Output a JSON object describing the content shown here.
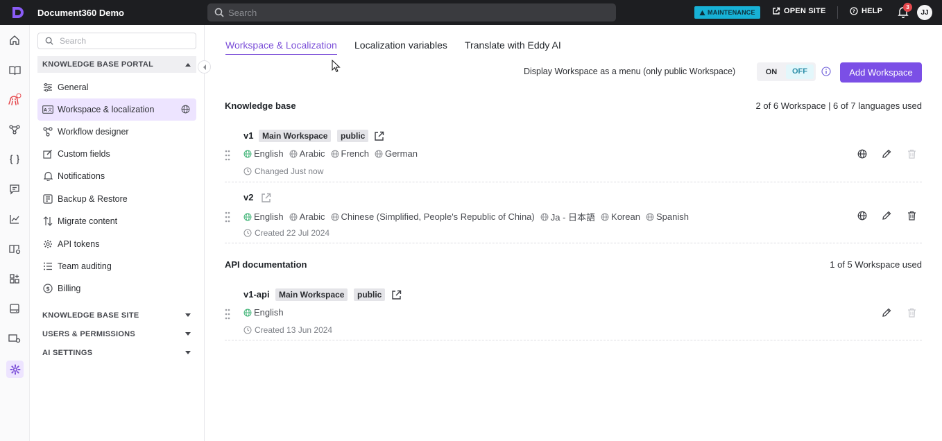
{
  "header": {
    "app_title": "Document360 Demo",
    "search_placeholder": "Search",
    "maintenance_label": "MAINTENANCE",
    "open_site_label": "OPEN SITE",
    "help_label": "HELP",
    "notification_count": "3",
    "user_initials": "JJ"
  },
  "sidebar": {
    "search_placeholder": "Search",
    "portal_section": "KNOWLEDGE BASE PORTAL",
    "items": [
      {
        "label": "General",
        "icon": "sliders-icon"
      },
      {
        "label": "Workspace & localization",
        "icon": "translate-icon"
      },
      {
        "label": "Workflow designer",
        "icon": "workflow-icon"
      },
      {
        "label": "Custom fields",
        "icon": "edit-field-icon"
      },
      {
        "label": "Notifications",
        "icon": "bell-icon"
      },
      {
        "label": "Backup & Restore",
        "icon": "backup-icon"
      },
      {
        "label": "Migrate content",
        "icon": "migrate-icon"
      },
      {
        "label": "API tokens",
        "icon": "gear-token-icon"
      },
      {
        "label": "Team auditing",
        "icon": "list-audit-icon"
      },
      {
        "label": "Billing",
        "icon": "dollar-icon"
      }
    ],
    "other_sections": [
      "KNOWLEDGE BASE SITE",
      "USERS & PERMISSIONS",
      "AI SETTINGS"
    ]
  },
  "tabs": [
    "Workspace & Localization",
    "Localization variables",
    "Translate with Eddy AI"
  ],
  "display_menu": {
    "label": "Display Workspace as a menu (only public Workspace)",
    "on_label": "ON",
    "off_label": "OFF",
    "selected": "OFF"
  },
  "add_workspace_label": "Add Workspace",
  "groups": {
    "kb": {
      "title": "Knowledge base",
      "usage": "2 of 6 Workspace | 6 of 7 languages used",
      "workspaces": [
        {
          "name": "v1",
          "tags": [
            "Main Workspace",
            "public"
          ],
          "languages": [
            "English",
            "Arabic",
            "French",
            "German"
          ],
          "meta": "Changed Just now"
        },
        {
          "name": "v2",
          "tags": [],
          "languages": [
            "English",
            "Arabic",
            "Chinese (Simplified, People's Republic of China)",
            "Ja - 日本語",
            "Korean",
            "Spanish"
          ],
          "meta": "Created 22 Jul 2024"
        }
      ]
    },
    "api": {
      "title": "API documentation",
      "usage": "1 of 5 Workspace used",
      "workspaces": [
        {
          "name": "v1-api",
          "tags": [
            "Main Workspace",
            "public"
          ],
          "languages": [
            "English"
          ],
          "meta": "Created 13 Jun 2024"
        }
      ]
    }
  },
  "colors": {
    "accent": "#7b4fe6",
    "topbar": "#1d1e21",
    "maintenance": "#17b1d6",
    "active_bg": "#ede4ff"
  }
}
